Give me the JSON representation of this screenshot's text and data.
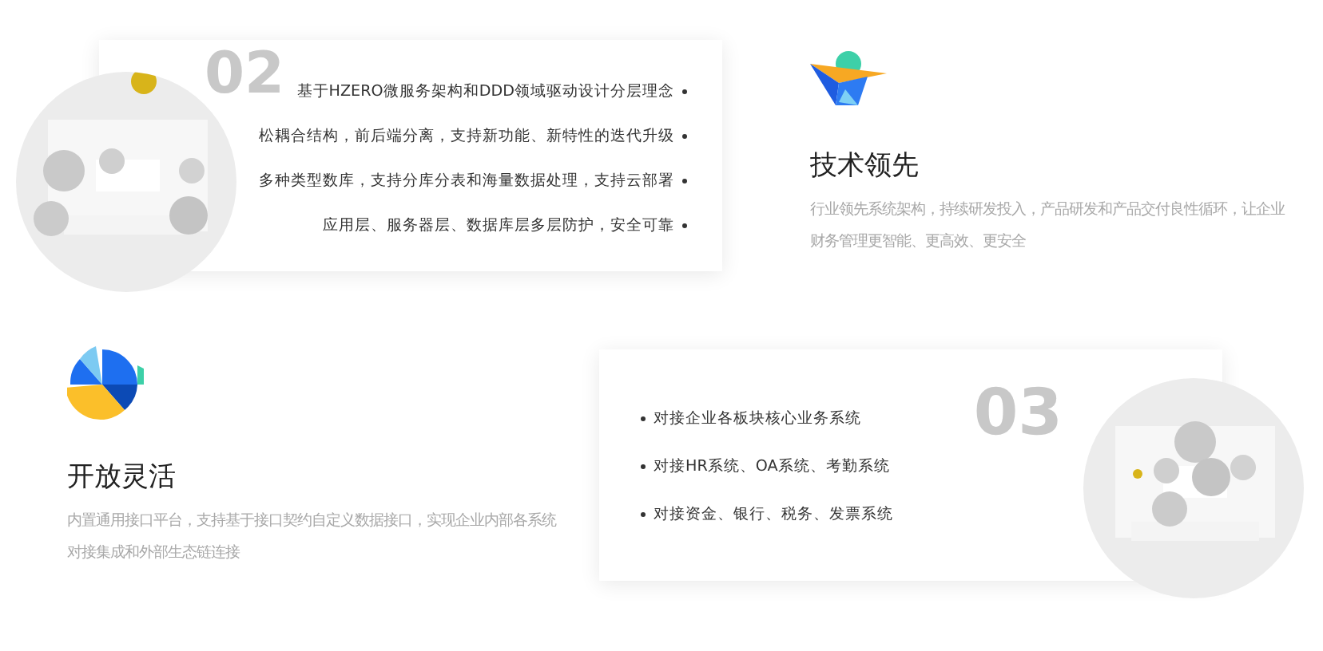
{
  "sections": [
    {
      "card": {
        "number": "02",
        "points": [
          "基于HZERO微服务架构和DDD领域驱动设计分层理念",
          "松耦合结构，前后端分离，支持新功能、新特性的迭代升级",
          "多种类型数库，支持分库分表和海量数据处理，支持云部署",
          "应用层、服务器层、数据库层多层防护，安全可靠"
        ],
        "picture": {
          "kind": "picture"
        }
      },
      "feature": {
        "title": "技术领先",
        "description": "行业领先系统架构，持续研发投入，产品研发和产品交付良性循环，让企业财务管理更智能、更高效、更安全"
      }
    },
    {
      "card": {
        "number": "03",
        "points": [
          "对接企业各板块核心业务系统",
          "对接HR系统、OA系统、考勤系统",
          "对接资金、银行、税务、发票系统"
        ],
        "picture": {
          "kind": "picture"
        }
      },
      "feature": {
        "title": "开放灵活",
        "description": "内置通用接口平台，支持基于接口契约自定义数据接口，实现企业内部各系统对接集成和外部生态链连接"
      }
    }
  ]
}
